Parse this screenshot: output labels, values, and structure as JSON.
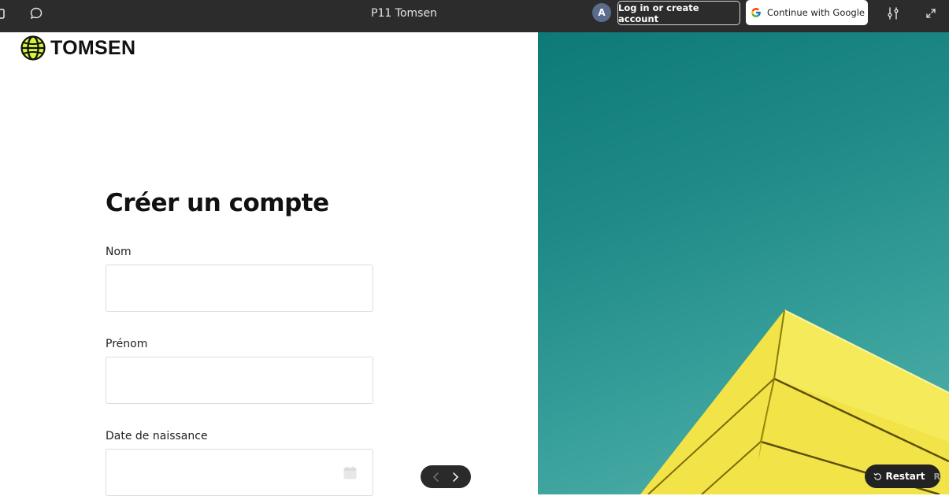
{
  "toolbar": {
    "title": "P11 Tomsen",
    "avatar_letter": "A",
    "login_label": "Log in or create account",
    "google_label": "Continue with Google",
    "icons": [
      "square-icon",
      "comment-icon",
      "settings-sliders-icon",
      "expand-icon"
    ]
  },
  "brand": {
    "name": "TOMSEN",
    "accent": "#d9f23a"
  },
  "form": {
    "heading": "Créer un compte",
    "fields": [
      {
        "label": "Nom",
        "value": ""
      },
      {
        "label": "Prénom",
        "value": ""
      },
      {
        "label": "Date de naissance",
        "value": ""
      }
    ]
  },
  "pager": {
    "prev_icon": "chevron-left-icon",
    "next_icon": "chevron-right-icon"
  },
  "restart": {
    "label": "Restart",
    "shortcut": "R"
  },
  "colors": {
    "toolbar_bg": "#2c2c2c",
    "hero_teal": "#1f8a88",
    "building_yellow": "#f4e44a"
  }
}
